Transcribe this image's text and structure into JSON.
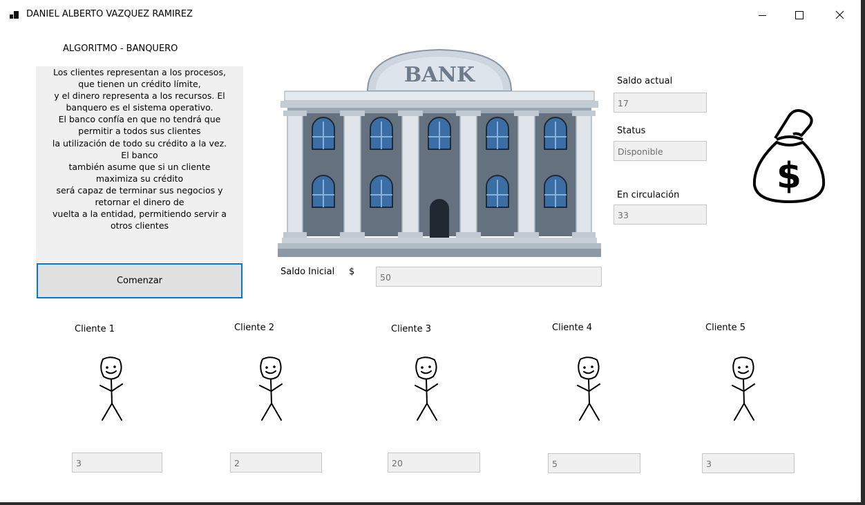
{
  "window": {
    "title": "DANIEL ALBERTO VAZQUEZ RAMIREZ",
    "controls": {
      "minimize": "—",
      "maximize": "☐",
      "close": "✕"
    }
  },
  "algorithm": {
    "heading": "ALGORITMO - BANQUERO",
    "description": "Los clientes representan a los procesos,\nque tienen un crédito límite,\ny el dinero representa a los recursos. El\nbanquero es el sistema operativo.\nEl banco confía en que no tendrá que\npermitir a todos sus clientes\nla utilización de todo su crédito a la vez.\nEl banco\ntambién asume que si un cliente\nmaximiza su crédito\nserá capaz de terminar sus negocios y\nretornar el dinero de\nvuelta a la entidad, permitiendo servir a\notros clientes"
  },
  "start_button": "Comenzar",
  "bank_sign": "BANK",
  "saldo_inicial": {
    "label": "Saldo Inicial",
    "currency": "$",
    "value": "50"
  },
  "status_panel": {
    "saldo_actual_label": "Saldo actual",
    "saldo_actual_value": "17",
    "status_label": "Status",
    "status_value": "Disponible",
    "circulacion_label": "En circulación",
    "circulacion_value": "33"
  },
  "money_bag_symbol": "$",
  "clients": [
    {
      "label": "Cliente 1",
      "value": "3"
    },
    {
      "label": "Cliente 2",
      "value": "2"
    },
    {
      "label": "Cliente 3",
      "value": "20"
    },
    {
      "label": "Cliente 4",
      "value": "5"
    },
    {
      "label": "Cliente 5",
      "value": "3"
    }
  ],
  "colors": {
    "focus_border": "#0078d7",
    "panel_bg": "#f0f0f0",
    "button_bg": "#e1e1e1"
  }
}
